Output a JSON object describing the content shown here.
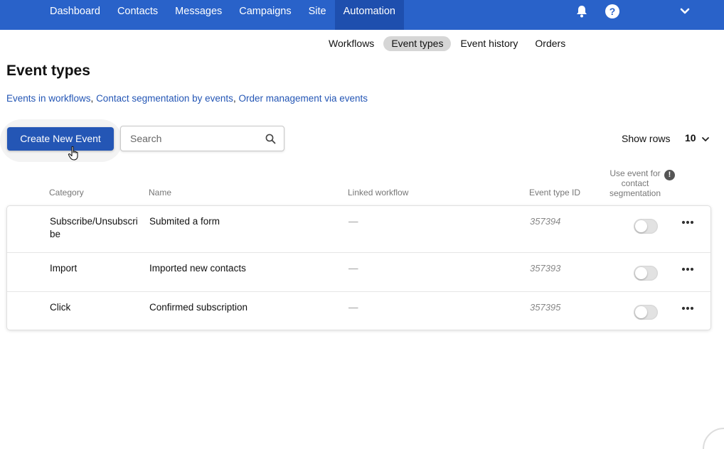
{
  "top_nav": {
    "items": [
      {
        "label": "Dashboard"
      },
      {
        "label": "Contacts"
      },
      {
        "label": "Messages"
      },
      {
        "label": "Campaigns"
      },
      {
        "label": "Site"
      },
      {
        "label": "Automation",
        "active": true
      }
    ],
    "bell_icon": "bell-icon",
    "help_icon": "help-icon",
    "help_glyph": "?",
    "account_icon": "chevron-down-icon",
    "brand_color": "#2962c9"
  },
  "sub_tabs": [
    {
      "label": "Workflows"
    },
    {
      "label": "Event types",
      "active": true
    },
    {
      "label": "Event history"
    },
    {
      "label": "Orders"
    }
  ],
  "page": {
    "title": "Event types",
    "help_links": [
      "Events in workflows",
      "Contact segmentation by events",
      "Order management via events"
    ],
    "link_separator": ", "
  },
  "toolbar": {
    "create_label": "Create New Event",
    "search_placeholder": "Search",
    "show_rows_label": "Show rows",
    "rows_value": "10"
  },
  "table": {
    "headers": {
      "category": "Category",
      "name": "Name",
      "linked_workflow": "Linked workflow",
      "event_type_id": "Event type ID",
      "segmentation": "Use event for contact segmentation",
      "info_glyph": "!"
    },
    "rows": [
      {
        "category": "Subscribe/Unsubscribe",
        "name": "Submited a form",
        "linked_workflow": "—",
        "event_type_id": "357394",
        "segmentation": false
      },
      {
        "category": "Import",
        "name": "Imported new contacts",
        "linked_workflow": "—",
        "event_type_id": "357393",
        "segmentation": false
      },
      {
        "category": "Click",
        "name": "Confirmed subscription",
        "linked_workflow": "—",
        "event_type_id": "357395",
        "segmentation": false
      }
    ]
  }
}
